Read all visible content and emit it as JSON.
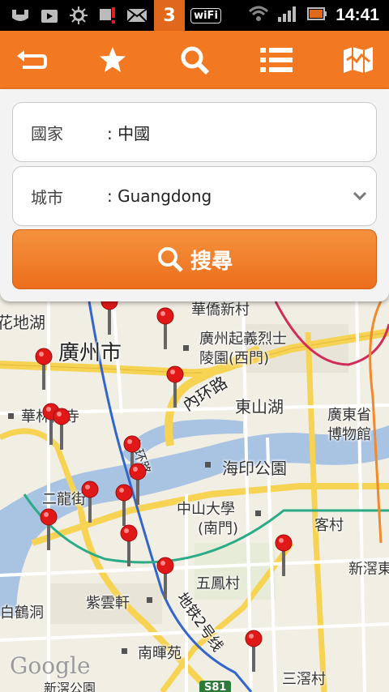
{
  "status_bar": {
    "time": "14:41",
    "carrier_badge": "3",
    "wifi_badge": "wiFi",
    "icons": [
      "usb-icon",
      "media-icon",
      "debug-icon",
      "alert-icon",
      "mail-icon",
      "carrier-icon",
      "wifi-badge-icon",
      "wifi-signal-icon",
      "cell-signal-icon",
      "battery-icon"
    ]
  },
  "toolbar": {
    "buttons": [
      "back-icon",
      "favorite-star-icon",
      "search-icon",
      "list-icon",
      "map-icon"
    ]
  },
  "search_form": {
    "country_label": "國家",
    "country_value": ": 中國",
    "city_label": "城市",
    "city_value": ": Guangdong",
    "search_button_label": "搜尋"
  },
  "map": {
    "labels": {
      "guangzhou": "廣州市",
      "huadi": "花地湖",
      "martyrs_1": "廣州起義烈士",
      "martyrs_2": "陵園(西門)",
      "ring_road": "內环路",
      "dongshan": "東山湖",
      "museum_1": "廣東省",
      "museum_2": "博物館",
      "hualin": "華林禪寺",
      "haiyin": "海印公園",
      "erlong": "二龍街",
      "sysu_1": "中山大學",
      "sysu_2": "(南門)",
      "kecun": "客村",
      "xinjiao": "新滘東",
      "wufeng": "五鳳村",
      "ziyun": "紫雲軒",
      "baihe": "白鶴洞",
      "metro2": "地铁2号线",
      "nanhui": "南暉苑",
      "sanjiao": "三滘村",
      "xinjiao_park": "新滘公園",
      "top_partial": "華僑新村",
      "highway": "S81",
      "ring_road_2": "內环路"
    },
    "attribution": "Google",
    "colors": {
      "water": "#a9c3e3",
      "road_major": "#f7d354",
      "road_minor": "#ffffff",
      "metro_blue": "#3366cc",
      "metro_green": "#2bab86",
      "metro_red": "#d12d5a",
      "metro_orange": "#f08a2d",
      "pin": "#e01818"
    }
  }
}
